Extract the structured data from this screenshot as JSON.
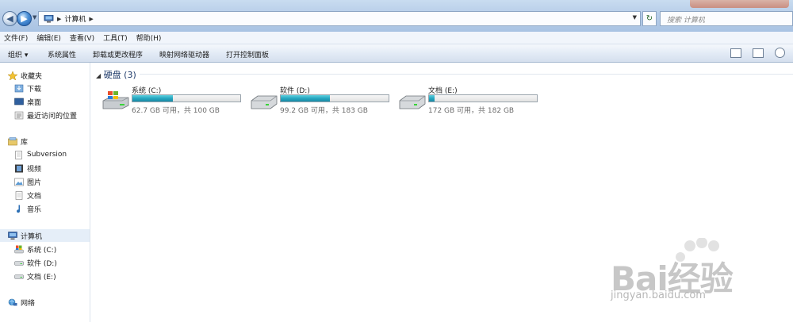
{
  "address": {
    "crumbs": [
      "计算机"
    ],
    "search_placeholder": "搜索 计算机"
  },
  "menu": [
    "文件(F)",
    "编辑(E)",
    "查看(V)",
    "工具(T)",
    "帮助(H)"
  ],
  "commands": [
    "组织 ▾",
    "系统属性",
    "卸载或更改程序",
    "映射网络驱动器",
    "打开控制面板"
  ],
  "nav": {
    "favorites": {
      "header": "收藏夹",
      "items": [
        "下载",
        "桌面",
        "最近访问的位置"
      ]
    },
    "libraries": {
      "header": "库",
      "items": [
        "Subversion",
        "视频",
        "图片",
        "文档",
        "音乐"
      ]
    },
    "computer": {
      "header": "计算机",
      "items": [
        "系统 (C:)",
        "软件 (D:)",
        "文档 (E:)"
      ]
    },
    "network": {
      "header": "网络"
    }
  },
  "group": {
    "title": "硬盘 (3)"
  },
  "drives": [
    {
      "name": "系统 (C:)",
      "size_text": "62.7 GB 可用，共 100 GB",
      "used_fraction": 0.373
    },
    {
      "name": "软件 (D:)",
      "size_text": "99.2 GB 可用，共 183 GB",
      "used_fraction": 0.458
    },
    {
      "name": "文档 (E:)",
      "size_text": "172 GB 可用，共 182 GB",
      "used_fraction": 0.055
    }
  ],
  "watermark": {
    "brand": "Bai经验",
    "url": "jingyan.baidu.com"
  },
  "colors": {
    "accent": "#26a7c0",
    "header_text": "#1e3a6a"
  }
}
